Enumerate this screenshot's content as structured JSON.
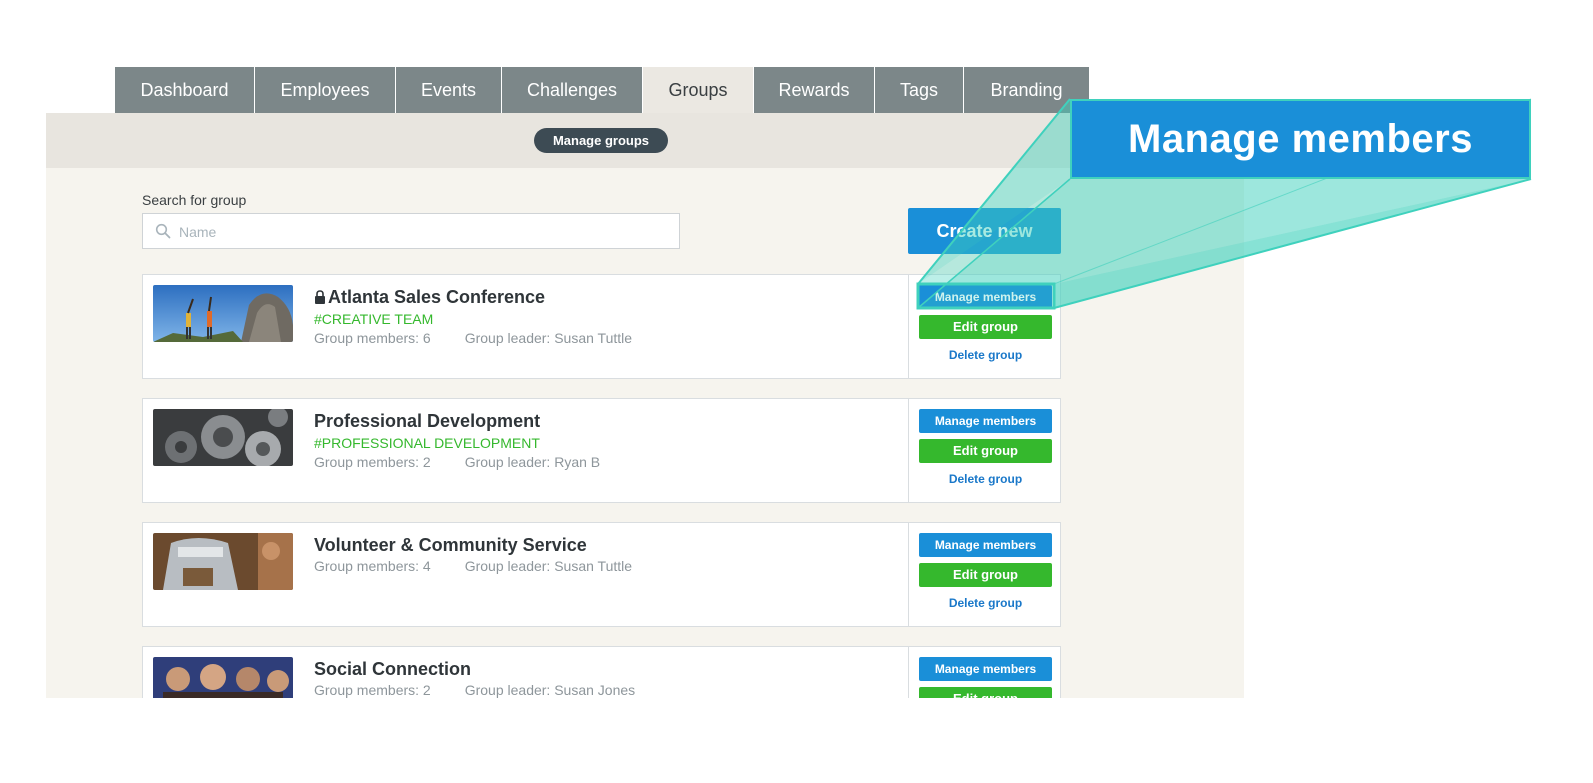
{
  "tabs": [
    {
      "label": "Dashboard",
      "active": false
    },
    {
      "label": "Employees",
      "active": false
    },
    {
      "label": "Events",
      "active": false
    },
    {
      "label": "Challenges",
      "active": false
    },
    {
      "label": "Groups",
      "active": true
    },
    {
      "label": "Rewards",
      "active": false
    },
    {
      "label": "Tags",
      "active": false
    },
    {
      "label": "Branding",
      "active": false
    }
  ],
  "subnav": {
    "pill_label": "Manage groups"
  },
  "search": {
    "label": "Search for group",
    "placeholder": "Name",
    "value": ""
  },
  "create_button": {
    "label": "Create new"
  },
  "groups": [
    {
      "title": "Atlanta Sales Conference",
      "locked": true,
      "tag": "#CREATIVE TEAM",
      "members": "Group members: 6",
      "leader": "Group leader: Susan Tuttle",
      "image_icon": "climbers-photo"
    },
    {
      "title": "Professional Development",
      "locked": false,
      "tag": "#PROFESSIONAL DEVELOPMENT",
      "members": "Group members: 2",
      "leader": "Group leader: Ryan B",
      "image_icon": "gears-photo"
    },
    {
      "title": "Volunteer & Community Service",
      "locked": false,
      "tag": "",
      "members": "Group members: 4",
      "leader": "Group leader: Susan Tuttle",
      "image_icon": "volunteer-photo"
    },
    {
      "title": "Social Connection",
      "locked": false,
      "tag": "",
      "members": "Group members: 2",
      "leader": "Group leader: Susan Jones",
      "image_icon": "people-photo"
    }
  ],
  "actions": {
    "manage": "Manage members",
    "edit": "Edit group",
    "delete": "Delete group"
  },
  "callout": {
    "label": "Manage members"
  },
  "colors": {
    "tab_bg": "#7c8789",
    "primary_blue": "#1a8fd8",
    "green": "#35b82d",
    "callout_teal": "#3fd1bd"
  }
}
